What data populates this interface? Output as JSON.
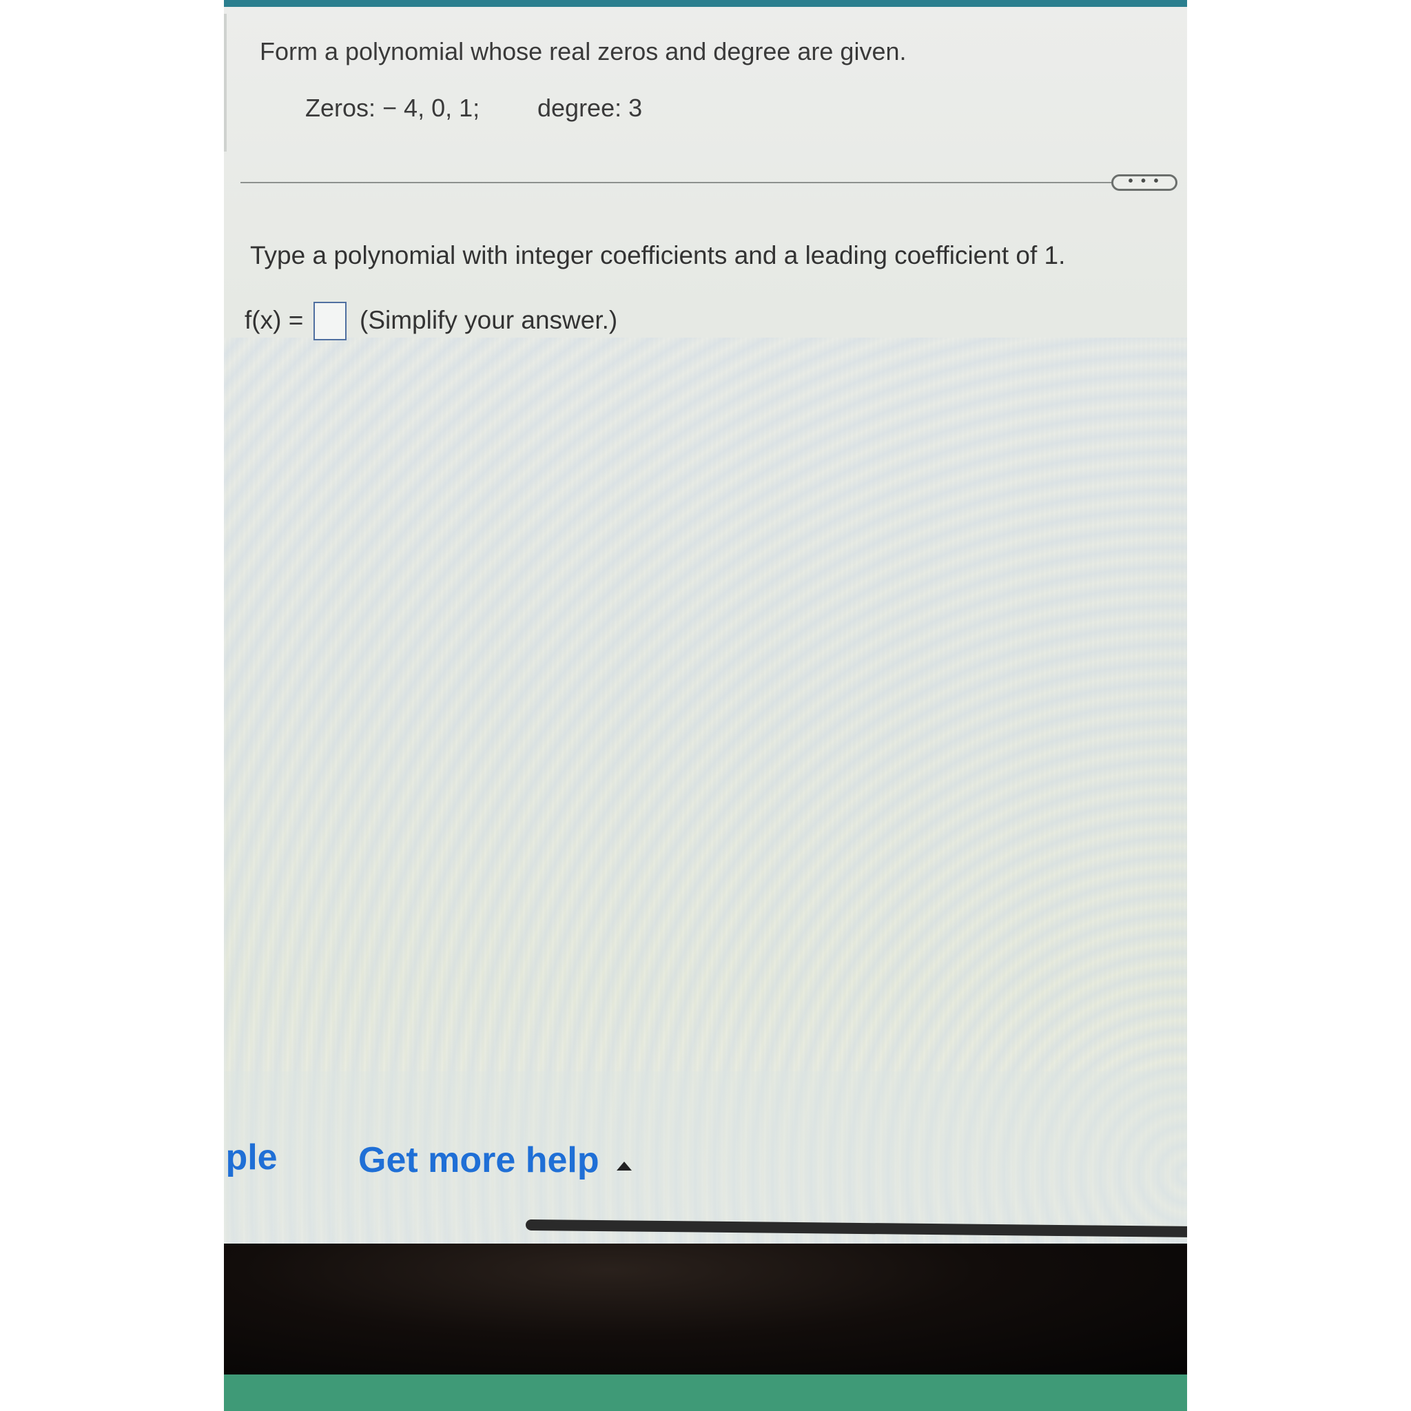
{
  "problem": {
    "title": "Form a polynomial whose real zeros and degree are given.",
    "zeros_text": "Zeros:  − 4, 0, 1;",
    "degree_text": "degree: 3"
  },
  "more_button": {
    "label": "• • •"
  },
  "answer": {
    "instruction": "Type a polynomial with integer coefficients and a leading coefficient of 1.",
    "fx_label": "f(x) =",
    "value": "",
    "note": "(Simplify your answer.)"
  },
  "footer": {
    "example_label": "ıple",
    "help_label": "Get more help"
  },
  "icons": {
    "caret": "caret-up-icon",
    "more": "ellipsis-icon"
  },
  "colors": {
    "top_bar": "#2a7e8e",
    "link": "#1f6fd6",
    "text": "#333333"
  }
}
